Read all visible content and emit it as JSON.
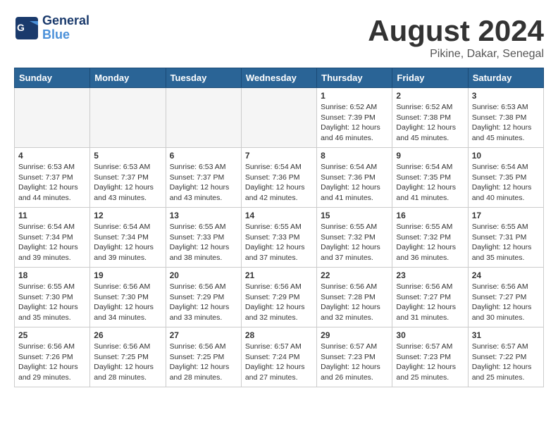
{
  "header": {
    "logo_general": "General",
    "logo_blue": "Blue",
    "month_year": "August 2024",
    "location": "Pikine, Dakar, Senegal"
  },
  "weekdays": [
    "Sunday",
    "Monday",
    "Tuesday",
    "Wednesday",
    "Thursday",
    "Friday",
    "Saturday"
  ],
  "weeks": [
    [
      {
        "day": "",
        "sunrise": "",
        "sunset": "",
        "daylight": "",
        "empty": true
      },
      {
        "day": "",
        "sunrise": "",
        "sunset": "",
        "daylight": "",
        "empty": true
      },
      {
        "day": "",
        "sunrise": "",
        "sunset": "",
        "daylight": "",
        "empty": true
      },
      {
        "day": "",
        "sunrise": "",
        "sunset": "",
        "daylight": "",
        "empty": true
      },
      {
        "day": "1",
        "sunrise": "Sunrise: 6:52 AM",
        "sunset": "Sunset: 7:39 PM",
        "daylight": "Daylight: 12 hours and 46 minutes."
      },
      {
        "day": "2",
        "sunrise": "Sunrise: 6:52 AM",
        "sunset": "Sunset: 7:38 PM",
        "daylight": "Daylight: 12 hours and 45 minutes."
      },
      {
        "day": "3",
        "sunrise": "Sunrise: 6:53 AM",
        "sunset": "Sunset: 7:38 PM",
        "daylight": "Daylight: 12 hours and 45 minutes."
      }
    ],
    [
      {
        "day": "4",
        "sunrise": "Sunrise: 6:53 AM",
        "sunset": "Sunset: 7:37 PM",
        "daylight": "Daylight: 12 hours and 44 minutes."
      },
      {
        "day": "5",
        "sunrise": "Sunrise: 6:53 AM",
        "sunset": "Sunset: 7:37 PM",
        "daylight": "Daylight: 12 hours and 43 minutes."
      },
      {
        "day": "6",
        "sunrise": "Sunrise: 6:53 AM",
        "sunset": "Sunset: 7:37 PM",
        "daylight": "Daylight: 12 hours and 43 minutes."
      },
      {
        "day": "7",
        "sunrise": "Sunrise: 6:54 AM",
        "sunset": "Sunset: 7:36 PM",
        "daylight": "Daylight: 12 hours and 42 minutes."
      },
      {
        "day": "8",
        "sunrise": "Sunrise: 6:54 AM",
        "sunset": "Sunset: 7:36 PM",
        "daylight": "Daylight: 12 hours and 41 minutes."
      },
      {
        "day": "9",
        "sunrise": "Sunrise: 6:54 AM",
        "sunset": "Sunset: 7:35 PM",
        "daylight": "Daylight: 12 hours and 41 minutes."
      },
      {
        "day": "10",
        "sunrise": "Sunrise: 6:54 AM",
        "sunset": "Sunset: 7:35 PM",
        "daylight": "Daylight: 12 hours and 40 minutes."
      }
    ],
    [
      {
        "day": "11",
        "sunrise": "Sunrise: 6:54 AM",
        "sunset": "Sunset: 7:34 PM",
        "daylight": "Daylight: 12 hours and 39 minutes."
      },
      {
        "day": "12",
        "sunrise": "Sunrise: 6:54 AM",
        "sunset": "Sunset: 7:34 PM",
        "daylight": "Daylight: 12 hours and 39 minutes."
      },
      {
        "day": "13",
        "sunrise": "Sunrise: 6:55 AM",
        "sunset": "Sunset: 7:33 PM",
        "daylight": "Daylight: 12 hours and 38 minutes."
      },
      {
        "day": "14",
        "sunrise": "Sunrise: 6:55 AM",
        "sunset": "Sunset: 7:33 PM",
        "daylight": "Daylight: 12 hours and 37 minutes."
      },
      {
        "day": "15",
        "sunrise": "Sunrise: 6:55 AM",
        "sunset": "Sunset: 7:32 PM",
        "daylight": "Daylight: 12 hours and 37 minutes."
      },
      {
        "day": "16",
        "sunrise": "Sunrise: 6:55 AM",
        "sunset": "Sunset: 7:32 PM",
        "daylight": "Daylight: 12 hours and 36 minutes."
      },
      {
        "day": "17",
        "sunrise": "Sunrise: 6:55 AM",
        "sunset": "Sunset: 7:31 PM",
        "daylight": "Daylight: 12 hours and 35 minutes."
      }
    ],
    [
      {
        "day": "18",
        "sunrise": "Sunrise: 6:55 AM",
        "sunset": "Sunset: 7:30 PM",
        "daylight": "Daylight: 12 hours and 35 minutes."
      },
      {
        "day": "19",
        "sunrise": "Sunrise: 6:56 AM",
        "sunset": "Sunset: 7:30 PM",
        "daylight": "Daylight: 12 hours and 34 minutes."
      },
      {
        "day": "20",
        "sunrise": "Sunrise: 6:56 AM",
        "sunset": "Sunset: 7:29 PM",
        "daylight": "Daylight: 12 hours and 33 minutes."
      },
      {
        "day": "21",
        "sunrise": "Sunrise: 6:56 AM",
        "sunset": "Sunset: 7:29 PM",
        "daylight": "Daylight: 12 hours and 32 minutes."
      },
      {
        "day": "22",
        "sunrise": "Sunrise: 6:56 AM",
        "sunset": "Sunset: 7:28 PM",
        "daylight": "Daylight: 12 hours and 32 minutes."
      },
      {
        "day": "23",
        "sunrise": "Sunrise: 6:56 AM",
        "sunset": "Sunset: 7:27 PM",
        "daylight": "Daylight: 12 hours and 31 minutes."
      },
      {
        "day": "24",
        "sunrise": "Sunrise: 6:56 AM",
        "sunset": "Sunset: 7:27 PM",
        "daylight": "Daylight: 12 hours and 30 minutes."
      }
    ],
    [
      {
        "day": "25",
        "sunrise": "Sunrise: 6:56 AM",
        "sunset": "Sunset: 7:26 PM",
        "daylight": "Daylight: 12 hours and 29 minutes."
      },
      {
        "day": "26",
        "sunrise": "Sunrise: 6:56 AM",
        "sunset": "Sunset: 7:25 PM",
        "daylight": "Daylight: 12 hours and 28 minutes."
      },
      {
        "day": "27",
        "sunrise": "Sunrise: 6:56 AM",
        "sunset": "Sunset: 7:25 PM",
        "daylight": "Daylight: 12 hours and 28 minutes."
      },
      {
        "day": "28",
        "sunrise": "Sunrise: 6:57 AM",
        "sunset": "Sunset: 7:24 PM",
        "daylight": "Daylight: 12 hours and 27 minutes."
      },
      {
        "day": "29",
        "sunrise": "Sunrise: 6:57 AM",
        "sunset": "Sunset: 7:23 PM",
        "daylight": "Daylight: 12 hours and 26 minutes."
      },
      {
        "day": "30",
        "sunrise": "Sunrise: 6:57 AM",
        "sunset": "Sunset: 7:23 PM",
        "daylight": "Daylight: 12 hours and 25 minutes."
      },
      {
        "day": "31",
        "sunrise": "Sunrise: 6:57 AM",
        "sunset": "Sunset: 7:22 PM",
        "daylight": "Daylight: 12 hours and 25 minutes."
      }
    ]
  ]
}
